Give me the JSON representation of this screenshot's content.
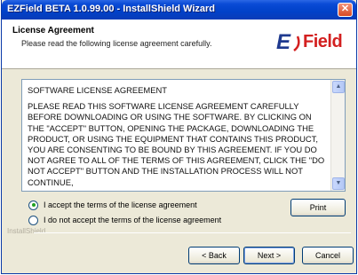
{
  "window": {
    "title": "EZField BETA 1.0.99.00 - InstallShield Wizard",
    "close_label": "✕"
  },
  "header": {
    "title": "License Agreement",
    "subtitle": "Please read the following license agreement carefully.",
    "logo_e": "E",
    "logo_field": "Field"
  },
  "license": {
    "heading": "SOFTWARE LICENSE AGREEMENT",
    "body": "PLEASE READ THIS SOFTWARE LICENSE AGREEMENT CAREFULLY BEFORE DOWNLOADING OR USING THE SOFTWARE. BY CLICKING ON THE \"ACCEPT\" BUTTON, OPENING THE PACKAGE, DOWNLOADING THE PRODUCT, OR USING THE EQUIPMENT THAT CONTAINS THIS PRODUCT, YOU ARE CONSENTING TO BE BOUND BY THIS AGREEMENT. IF YOU DO NOT AGREE TO ALL OF THE TERMS OF THIS AGREEMENT, CLICK THE \"DO NOT ACCEPT\" BUTTON AND THE INSTALLATION PROCESS WILL NOT CONTINUE,",
    "scroll_up": "▲",
    "scroll_down": "▼"
  },
  "options": {
    "accept_label": "I accept the terms of the license agreement",
    "decline_label": "I do not accept the terms of the license agreement",
    "selected": "accept"
  },
  "buttons": {
    "print": "Print",
    "back": "< Back",
    "next": "Next >",
    "cancel": "Cancel"
  },
  "footer": {
    "brand": "InstallShield"
  }
}
